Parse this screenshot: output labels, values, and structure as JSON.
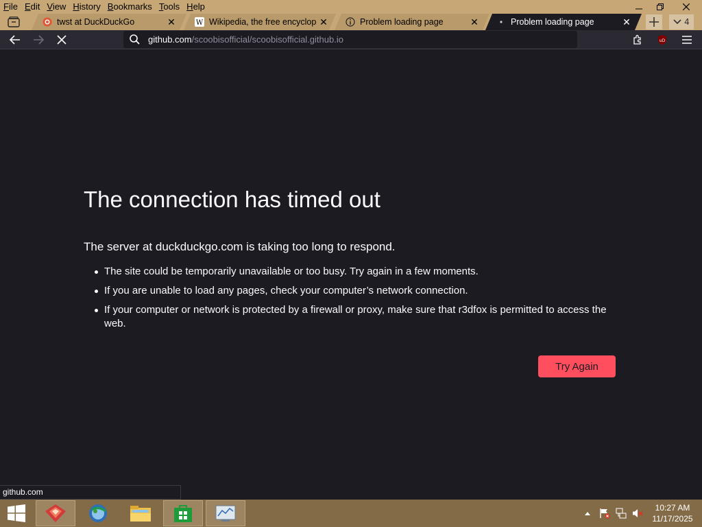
{
  "menu": [
    "File",
    "Edit",
    "View",
    "History",
    "Bookmarks",
    "Tools",
    "Help"
  ],
  "menu_underline": [
    "F",
    "E",
    "V",
    "H",
    "B",
    "T",
    "H"
  ],
  "tabs": [
    {
      "label": "twst at DuckDuckGo",
      "icon": "duckduckgo-icon"
    },
    {
      "label": "Wikipedia, the free encyclopedi",
      "icon": "wikipedia-icon"
    },
    {
      "label": "Problem loading page",
      "icon": "info-icon"
    },
    {
      "label": "Problem loading page",
      "icon": "loading-dot-icon",
      "active": true
    }
  ],
  "tab_count": "4",
  "url": {
    "host": "github.com",
    "path": "/scoobisofficial/scoobisofficial.github.io"
  },
  "error": {
    "title": "The connection has timed out",
    "subtitle": "The server at duckduckgo.com is taking too long to respond.",
    "items": [
      "The site could be temporarily unavailable or too busy. Try again in a few moments.",
      "If you are unable to load any pages, check your computer’s network connection.",
      "If your computer or network is protected by a firewall or proxy, make sure that r3dfox is permitted to access the web."
    ],
    "button": "Try Again"
  },
  "status_text": "github.com",
  "clock": {
    "time": "10:27 AM",
    "date": "11/17/2025"
  },
  "colors": {
    "accent": "#ff4f5e",
    "chrome": "#c7a776",
    "page_bg": "#1c1b22",
    "taskbar": "#826b46"
  }
}
